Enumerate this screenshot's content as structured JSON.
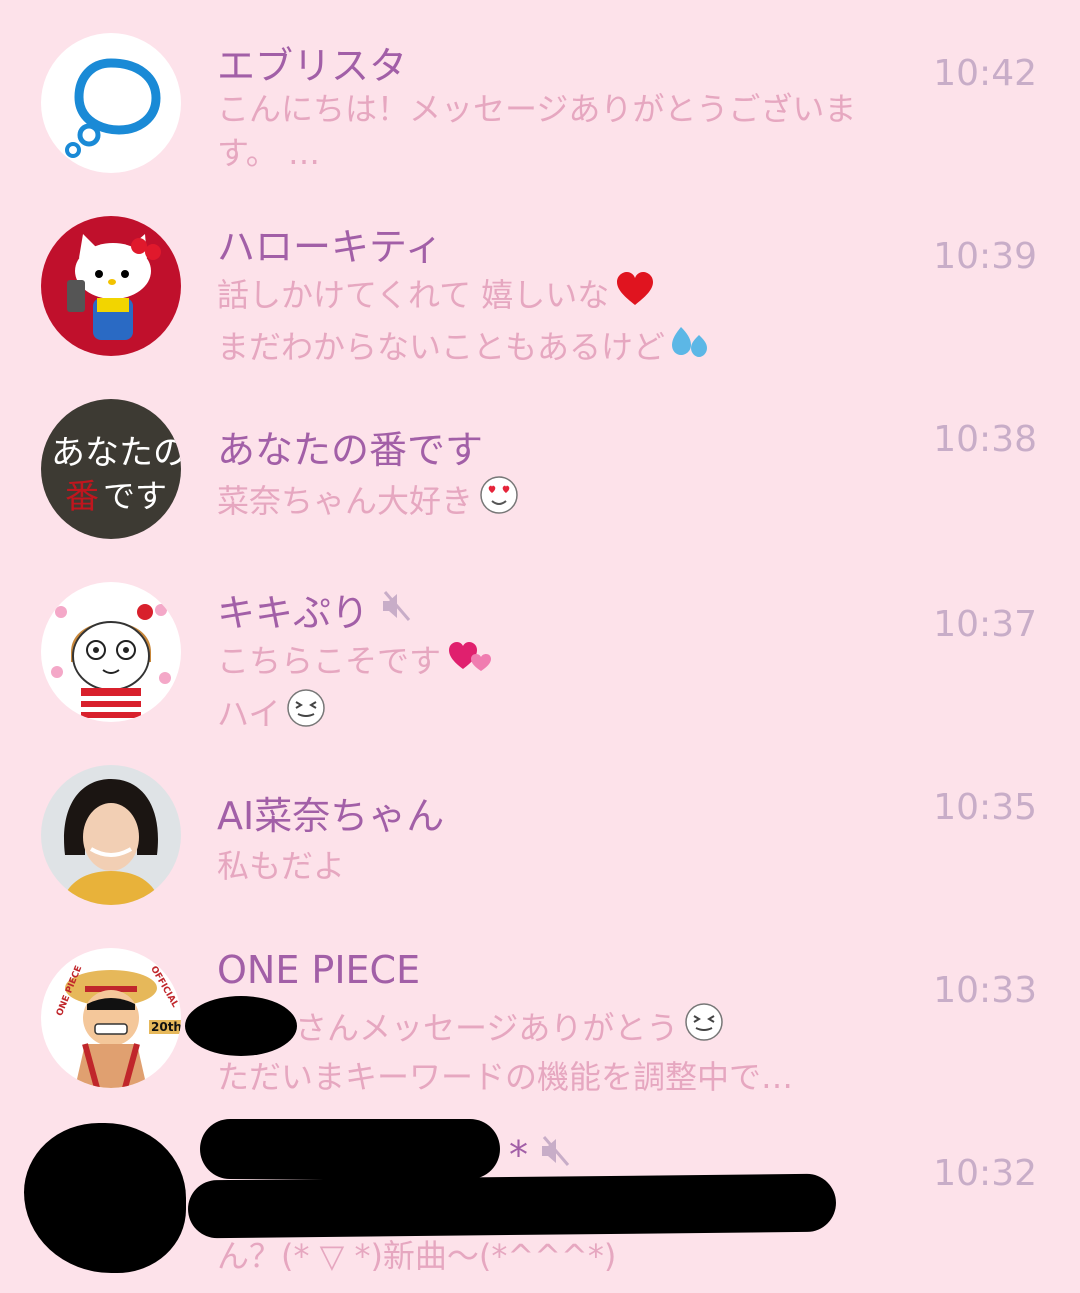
{
  "chats": [
    {
      "name": "エブリスタ",
      "time": "10:42",
      "line1": "こんにちは！メッセージありがとうございます。 …",
      "line2": ""
    },
    {
      "name": "ハローキティ",
      "time": "10:39",
      "line1": "話しかけてくれて 嬉しいな",
      "line2": "まだわからないこともあるけど"
    },
    {
      "name": "あなたの番です",
      "time": "10:38",
      "line1": "菜奈ちゃん大好き",
      "line2": "",
      "avatar_text1": "あなたの",
      "avatar_text2": "番",
      "avatar_text3": "です"
    },
    {
      "name": "キキぷり",
      "time": "10:37",
      "line1": "こちらこそです",
      "line2": "ハイ"
    },
    {
      "name": "AI菜奈ちゃん",
      "time": "10:35",
      "line1": "私もだよ",
      "line2": ""
    },
    {
      "name": "ONE PIECE",
      "time": "10:33",
      "line1": "さんメッセージありがとう",
      "line2": "ただいまキーワードの機能を調整中で…",
      "avatar_text1": "ONE PIECE",
      "avatar_text2": "OFFICIAL",
      "avatar_text3": "20th"
    },
    {
      "name": "*",
      "time": "10:32",
      "line1": "",
      "line2": "ん？(*    ▽    *)新曲～(*^^^*)"
    }
  ],
  "colors": {
    "background": "#fde2ea",
    "name": "#a25fa7",
    "message": "#e6a7c0",
    "time": "#c8adc8"
  },
  "icons": [
    "estar-bubble-icon",
    "heart-icon",
    "sweat-drop-icon",
    "heart-eyes-icon",
    "mute-icon",
    "double-heart-icon",
    "squint-face-icon"
  ]
}
